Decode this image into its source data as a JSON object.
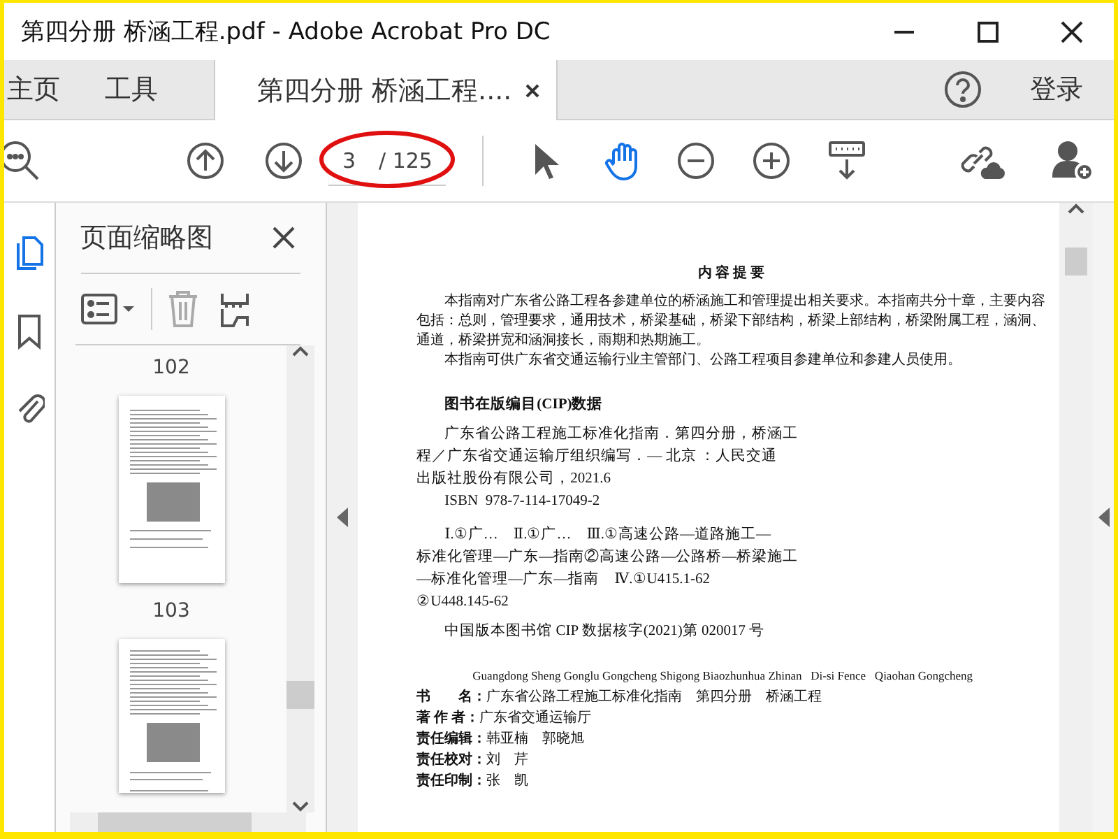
{
  "window": {
    "title": "第四分册  桥涵工程.pdf - Adobe Acrobat Pro DC"
  },
  "nav_tabs": [
    {
      "label": "主页",
      "selected": false
    },
    {
      "label": "工具",
      "selected": false
    },
    {
      "label": "第四分册  桥涵工程....",
      "selected": true
    }
  ],
  "account": {
    "sign_in": "登录"
  },
  "toolbar": {
    "tools": [
      {
        "kind": "zoom-search",
        "selected": false
      },
      {
        "kind": "prev-page",
        "selected": false
      },
      {
        "kind": "next-page",
        "selected": false
      },
      {
        "kind": "page-field",
        "selected": false
      },
      {
        "kind": "select",
        "selected": false
      },
      {
        "kind": "hand",
        "selected": true
      },
      {
        "kind": "zoom-out",
        "selected": false
      },
      {
        "kind": "zoom-in",
        "selected": false
      },
      {
        "kind": "scroll-mode",
        "selected": false
      }
    ],
    "page_input": {
      "value": "3"
    },
    "page_total": "/ 125"
  },
  "left_rail": [
    {
      "kind": "pages",
      "selected": true
    },
    {
      "kind": "bookmark",
      "selected": false
    },
    {
      "kind": "attachment",
      "selected": false
    }
  ],
  "sidebar": {
    "title": "页面缩略图",
    "thumbnail_labels": [
      "102",
      "103"
    ]
  },
  "document": {
    "heading": "内 容 提 要",
    "paragraphs": [
      "本指南对广东省公路工程各参建单位的桥涵施工和管理提出相关要求。本指南共分十章，主要内容包括：总则，管理要求，通用技术，桥梁基础，桥梁下部结构，桥梁上部结构，桥梁附属工程，涵洞、通道，桥梁拼宽和涵洞接长，雨期和热期施工。",
      "本指南可供广东省交通运输行业主管部门、公路工程项目参建单位和参建人员使用。"
    ],
    "cip_heading": "图书在版编目(CIP)数据",
    "cip_lines": [
      "广东省公路工程施工标准化指南．第四分册，桥涵工",
      "程／广东省交通运输厅组织编写．— 北京 ：人民交通",
      "出版社股份有限公司，2021.6",
      "ISBN  978-7-114-17049-2"
    ],
    "class_lines": [
      "Ⅰ.①广…　Ⅱ.①广…　Ⅲ.①高速公路—道路施工—",
      "标准化管理—广东—指南②高速公路—公路桥—桥梁施工",
      "—标准化管理—广东—指南　Ⅳ.①U415.1-62",
      "②U448.145-62"
    ],
    "cip_number": "中国版本图书馆 CIP 数据核字(2021)第 020017 号",
    "pinyin": "Guangdong Sheng Gonglu Gongcheng Shigong Biaozhunhua Zhinan   Di-si Fence   Qiaohan Gongcheng",
    "credits": [
      {
        "label": "书　　名：",
        "value": "广东省公路工程施工标准化指南　第四分册　桥涵工程"
      },
      {
        "label": "著 作 者：",
        "value": "广东省交通运输厅"
      },
      {
        "label": "责任编辑：",
        "value": "韩亚楠　郭晓旭"
      },
      {
        "label": "责任校对：",
        "value": "刘　芹"
      },
      {
        "label": "责任印制：",
        "value": "张　凯"
      }
    ]
  }
}
